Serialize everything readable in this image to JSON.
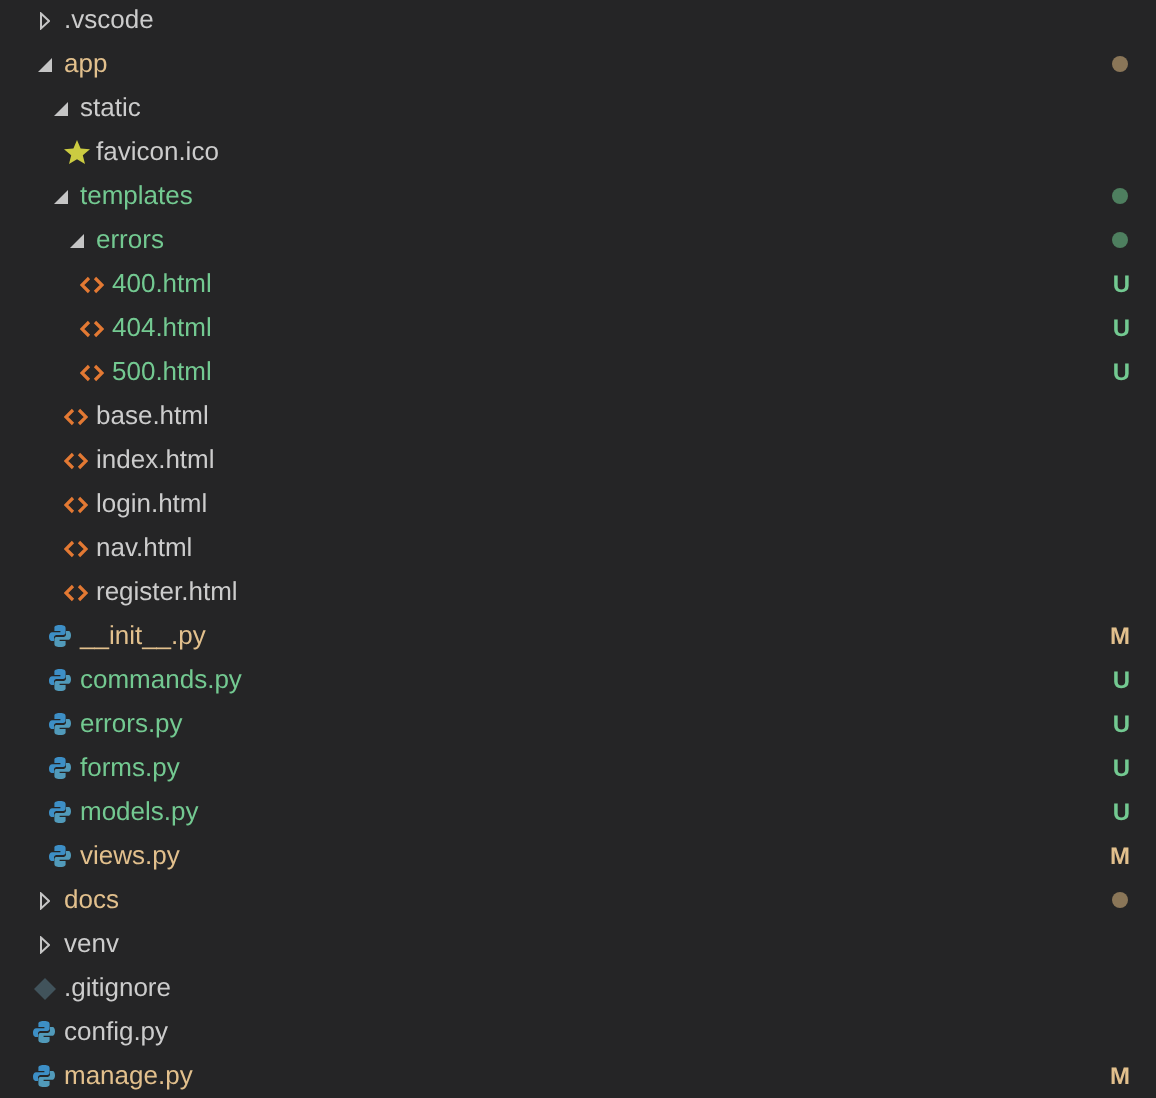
{
  "tree": [
    {
      "name": ".vscode",
      "kind": "folder",
      "expanded": false,
      "modified": false,
      "untracked": false
    },
    {
      "name": "app",
      "kind": "folder",
      "expanded": true,
      "modified": true,
      "untracked": false,
      "dot": true,
      "children": [
        {
          "name": "static",
          "kind": "folder",
          "expanded": true,
          "modified": false,
          "untracked": false,
          "children": [
            {
              "name": "favicon.ico",
              "kind": "star",
              "modified": false,
              "untracked": false
            }
          ]
        },
        {
          "name": "templates",
          "kind": "folder",
          "expanded": true,
          "modified": false,
          "untracked": true,
          "dot": true,
          "children": [
            {
              "name": "errors",
              "kind": "folder",
              "expanded": true,
              "modified": false,
              "untracked": true,
              "dot": true,
              "children": [
                {
                  "name": "400.html",
                  "kind": "html",
                  "modified": false,
                  "untracked": true,
                  "badge": "U"
                },
                {
                  "name": "404.html",
                  "kind": "html",
                  "modified": false,
                  "untracked": true,
                  "badge": "U"
                },
                {
                  "name": "500.html",
                  "kind": "html",
                  "modified": false,
                  "untracked": true,
                  "badge": "U"
                }
              ]
            },
            {
              "name": "base.html",
              "kind": "html",
              "modified": false,
              "untracked": false
            },
            {
              "name": "index.html",
              "kind": "html",
              "modified": false,
              "untracked": false
            },
            {
              "name": "login.html",
              "kind": "html",
              "modified": false,
              "untracked": false
            },
            {
              "name": "nav.html",
              "kind": "html",
              "modified": false,
              "untracked": false
            },
            {
              "name": "register.html",
              "kind": "html",
              "modified": false,
              "untracked": false
            }
          ]
        },
        {
          "name": "__init__.py",
          "kind": "python",
          "modified": true,
          "untracked": false,
          "badge": "M"
        },
        {
          "name": "commands.py",
          "kind": "python",
          "modified": false,
          "untracked": true,
          "badge": "U"
        },
        {
          "name": "errors.py",
          "kind": "python",
          "modified": false,
          "untracked": true,
          "badge": "U"
        },
        {
          "name": "forms.py",
          "kind": "python",
          "modified": false,
          "untracked": true,
          "badge": "U"
        },
        {
          "name": "models.py",
          "kind": "python",
          "modified": false,
          "untracked": true,
          "badge": "U"
        },
        {
          "name": "views.py",
          "kind": "python",
          "modified": true,
          "untracked": false,
          "badge": "M"
        }
      ]
    },
    {
      "name": "docs",
      "kind": "folder",
      "expanded": false,
      "modified": true,
      "untracked": false,
      "dot": true
    },
    {
      "name": "venv",
      "kind": "folder",
      "expanded": false,
      "modified": false,
      "untracked": false
    },
    {
      "name": ".gitignore",
      "kind": "git",
      "modified": false,
      "untracked": false
    },
    {
      "name": "config.py",
      "kind": "python",
      "modified": false,
      "untracked": false
    },
    {
      "name": "manage.py",
      "kind": "python",
      "modified": true,
      "untracked": false,
      "badge": "M"
    }
  ]
}
